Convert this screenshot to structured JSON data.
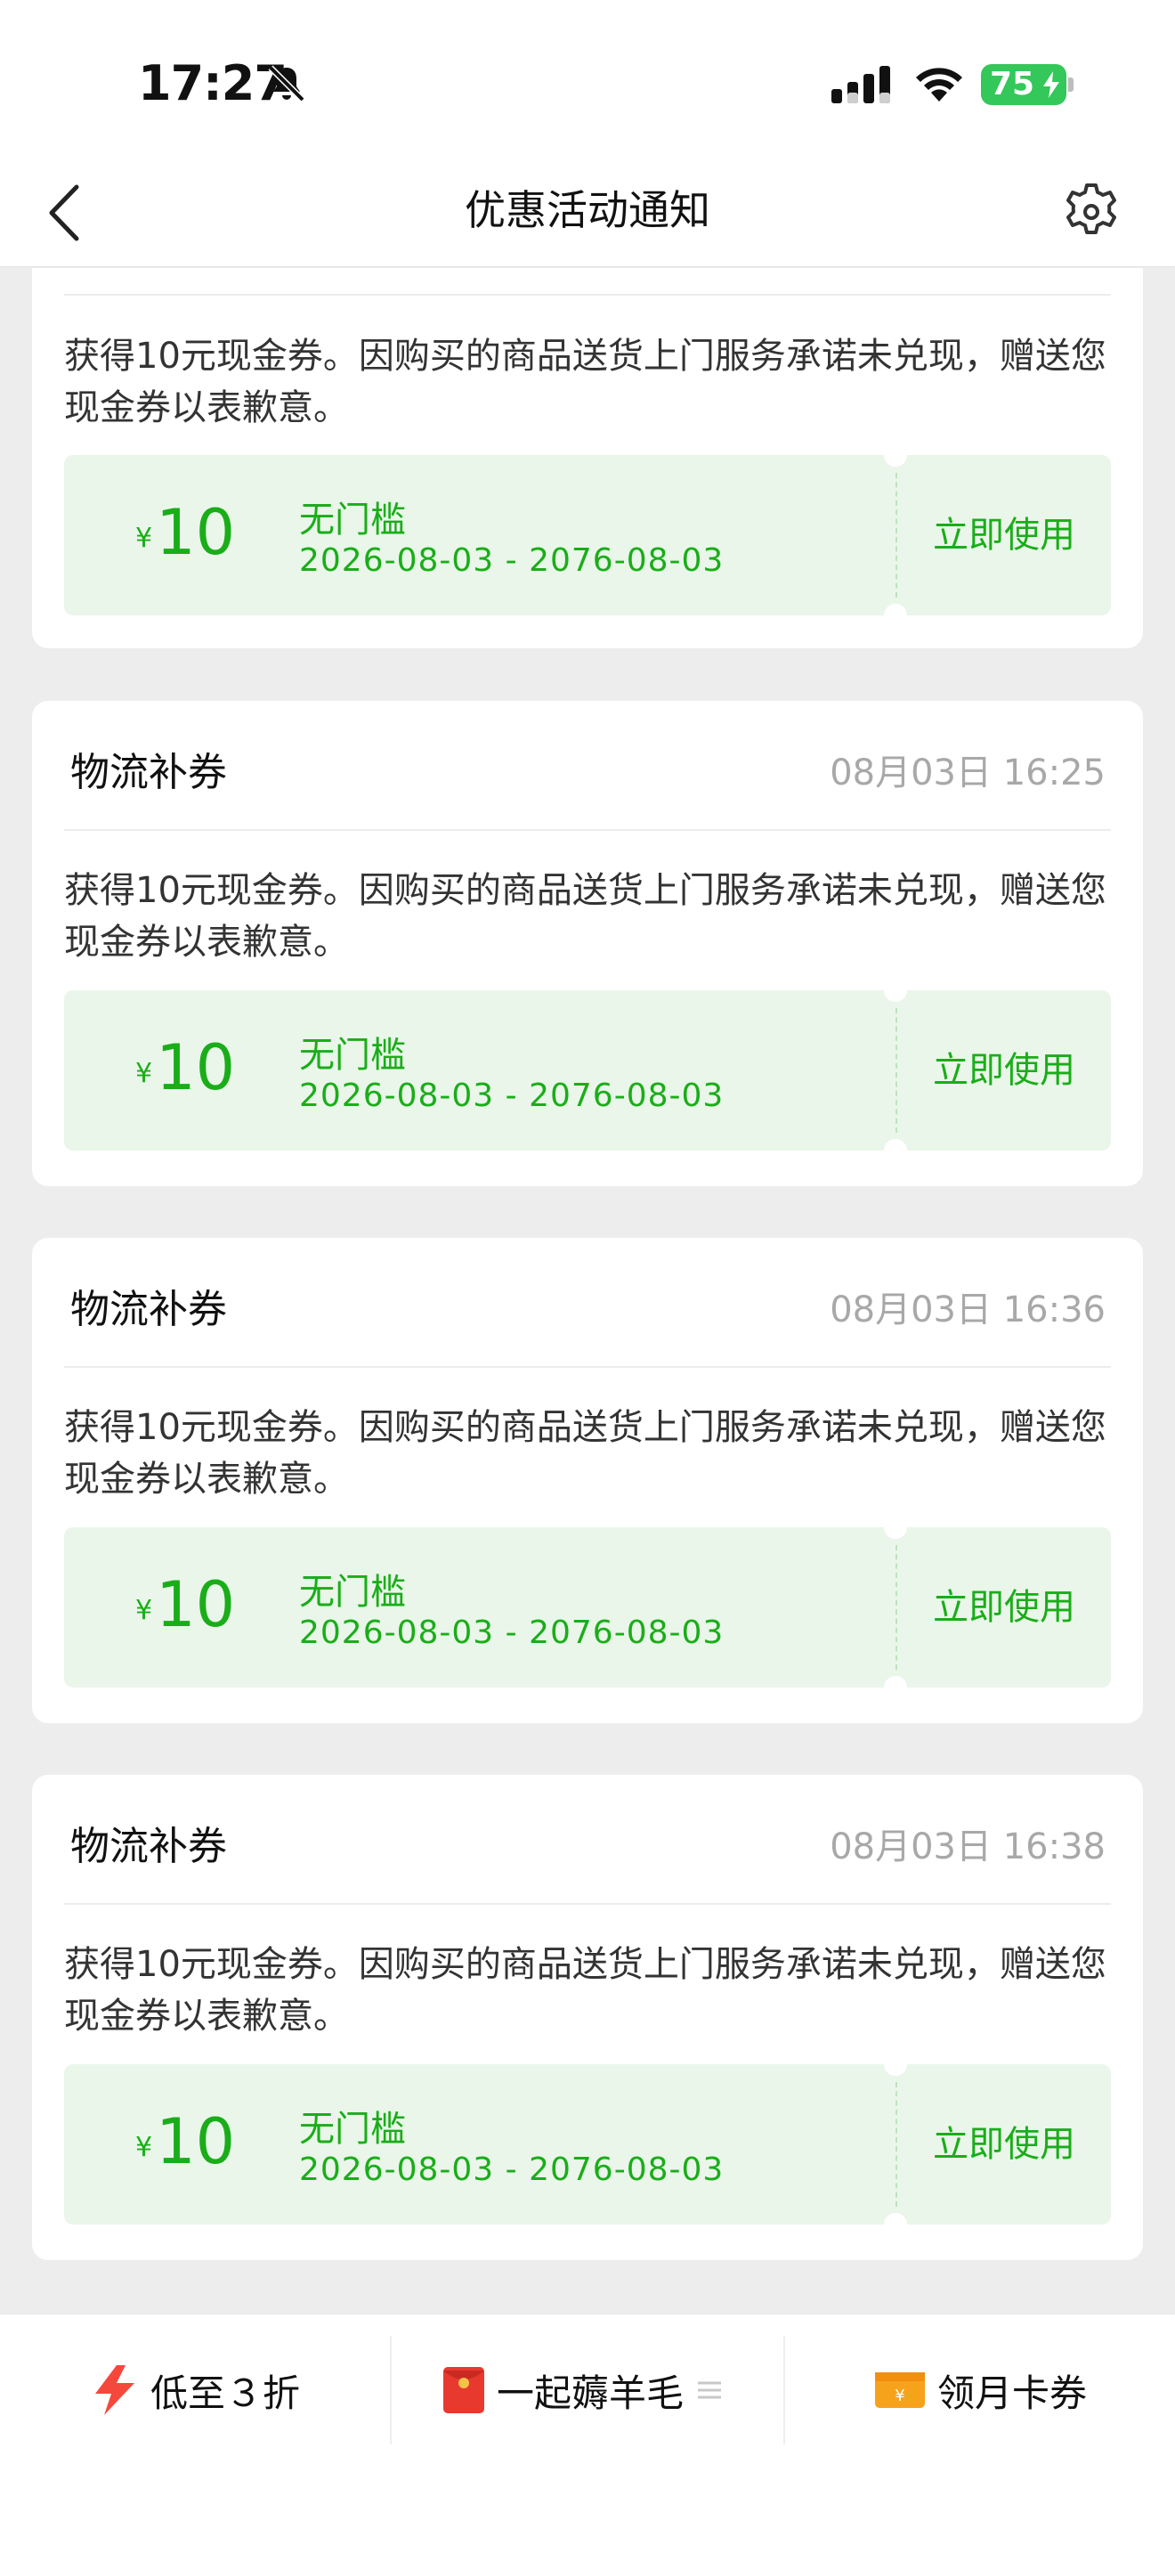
{
  "status_bar": {
    "time": "17:27",
    "battery": "75"
  },
  "nav": {
    "title": "优惠活动通知"
  },
  "colors": {
    "accent_green": "#1aad19",
    "coupon_bg": "#eaf6ea",
    "battery_green": "#34c759"
  },
  "icons": [
    "bell-slash-icon",
    "signal-icon",
    "wifi-icon",
    "battery-icon",
    "back-icon",
    "gear-icon",
    "lightning-icon",
    "red-envelope-icon",
    "menu-icon",
    "card-coupon-icon"
  ],
  "cards": [
    {
      "title": "",
      "time": "",
      "desc": "获得10元现金券。因购买的商品送货上门服务承诺未兑现，赠送您现金券以表歉意。",
      "coupon": {
        "currency": "¥",
        "value": "10",
        "condition": "无门槛",
        "range": "2026-08-03 - 2076-08-03",
        "action": "立即使用"
      }
    },
    {
      "title": "物流补券",
      "time": "08月03日 16:25",
      "desc": "获得10元现金券。因购买的商品送货上门服务承诺未兑现，赠送您现金券以表歉意。",
      "coupon": {
        "currency": "¥",
        "value": "10",
        "condition": "无门槛",
        "range": "2026-08-03 - 2076-08-03",
        "action": "立即使用"
      }
    },
    {
      "title": "物流补券",
      "time": "08月03日 16:36",
      "desc": "获得10元现金券。因购买的商品送货上门服务承诺未兑现，赠送您现金券以表歉意。",
      "coupon": {
        "currency": "¥",
        "value": "10",
        "condition": "无门槛",
        "range": "2026-08-03 - 2076-08-03",
        "action": "立即使用"
      }
    },
    {
      "title": "物流补券",
      "time": "08月03日 16:38",
      "desc": "获得10元现金券。因购买的商品送货上门服务承诺未兑现，赠送您现金券以表歉意。",
      "coupon": {
        "currency": "¥",
        "value": "10",
        "condition": "无门槛",
        "range": "2026-08-03 - 2076-08-03",
        "action": "立即使用"
      }
    }
  ],
  "bottom_bar": {
    "items": [
      {
        "label": "低至３折"
      },
      {
        "label": "一起薅羊毛"
      },
      {
        "label": "领月卡券"
      }
    ]
  }
}
